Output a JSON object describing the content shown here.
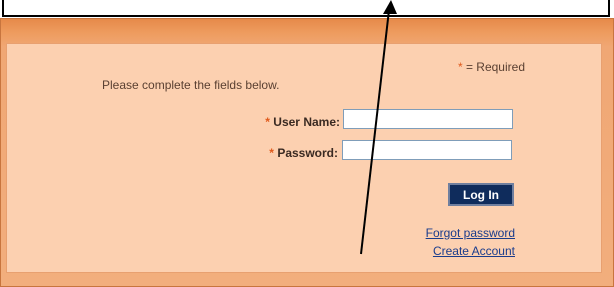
{
  "login": {
    "required_marker": "*",
    "required_note": "= Required",
    "instructions": "Please complete the fields below.",
    "fields": [
      {
        "label": "User Name:",
        "value": ""
      },
      {
        "label": "Password:",
        "value": ""
      }
    ],
    "submit_label": "Log In",
    "links": {
      "forgot_password": "Forgot password",
      "create_account": "Create Account"
    }
  },
  "colors": {
    "frame_orange": "#ee9c5f",
    "panel_peach": "#fcd0b0",
    "required_star": "#e05a1c",
    "button_navy": "#0f2c5c",
    "link_blue": "#1a3c8c"
  },
  "annotations": {
    "pointer": "arrow-pointer-icon"
  }
}
